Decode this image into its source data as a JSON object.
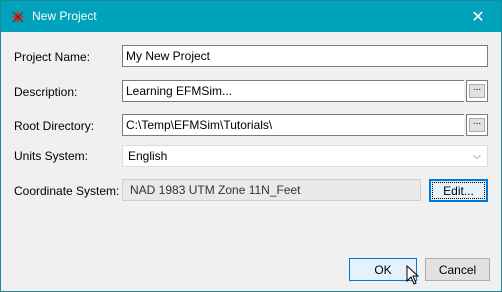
{
  "window": {
    "title": "New Project",
    "app_icon": "efmsim-app-icon",
    "close_glyph": "✕"
  },
  "form": {
    "project_name_label": "Project Name:",
    "project_name_value": "My New Project",
    "description_label": "Description:",
    "description_value": "Learning EFMSim...",
    "root_directory_label": "Root Directory:",
    "root_directory_value": "C:\\Temp\\EFMSim\\Tutorials\\",
    "units_label": "Units System:",
    "units_value": "English",
    "coordinate_label": "Coordinate System:",
    "coordinate_value": "NAD 1983 UTM Zone 11N_Feet",
    "browse_label": "...",
    "edit_label": "Edit..."
  },
  "buttons": {
    "ok_label": "OK",
    "cancel_label": "Cancel"
  },
  "colors": {
    "titlebar": "#00a3bb",
    "accent": "#0078d7"
  }
}
